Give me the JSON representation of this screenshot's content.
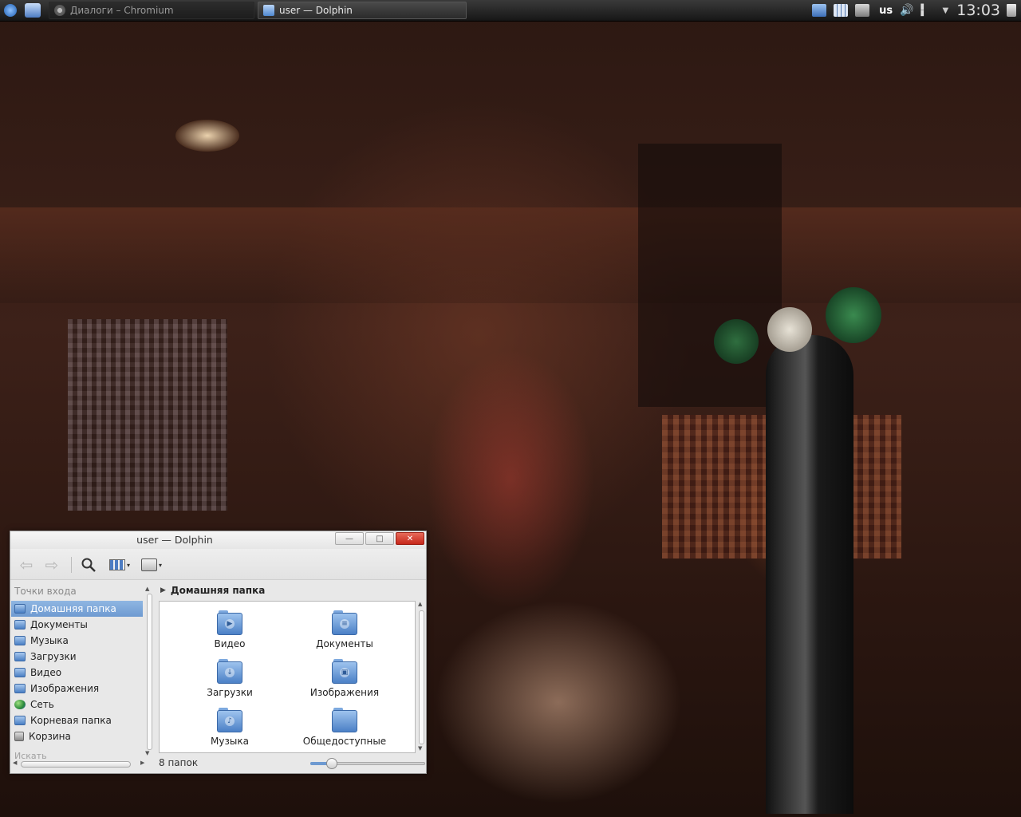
{
  "taskbar": {
    "tasks": [
      {
        "label": "Диалоги – Chromium",
        "icon": "chromium-icon",
        "active": false
      },
      {
        "label": "user — Dolphin",
        "icon": "folder-icon",
        "active": true
      }
    ],
    "tray": {
      "keyboard_layout": "us",
      "clock": "13:03",
      "icons": [
        "folder-icon",
        "grid-icon",
        "drive-icon",
        "volume-icon",
        "network-icon",
        "arrow-down-icon",
        "trash-icon"
      ]
    }
  },
  "window": {
    "title": "user — Dolphin",
    "controls": {
      "minimize": "—",
      "maximize": "□",
      "close": "✕"
    },
    "toolbar": {
      "back": "back-arrow-icon",
      "forward": "forward-arrow-icon",
      "search": "search-icon",
      "view_mode": "icons-view-icon",
      "preview": "camera-icon",
      "dropdown_glyph": "▾"
    },
    "sidebar": {
      "header": "Точки входа",
      "items": [
        {
          "label": "Домашняя папка",
          "icon": "home-folder-icon",
          "active": true
        },
        {
          "label": "Документы",
          "icon": "documents-folder-icon",
          "active": false
        },
        {
          "label": "Музыка",
          "icon": "music-folder-icon",
          "active": false
        },
        {
          "label": "Загрузки",
          "icon": "downloads-folder-icon",
          "active": false
        },
        {
          "label": "Видео",
          "icon": "video-folder-icon",
          "active": false
        },
        {
          "label": "Изображения",
          "icon": "pictures-folder-icon",
          "active": false
        },
        {
          "label": "Сеть",
          "icon": "network-globe-icon",
          "active": false
        },
        {
          "label": "Корневая папка",
          "icon": "root-folder-icon",
          "active": false
        },
        {
          "label": "Корзина",
          "icon": "trash-icon",
          "active": false
        }
      ],
      "search_header": "Искать"
    },
    "breadcrumb": {
      "arrow": "▶",
      "label": "Домашняя папка"
    },
    "files": [
      {
        "name": "Видео",
        "emblem": "▶"
      },
      {
        "name": "Документы",
        "emblem": "≡"
      },
      {
        "name": "Загрузки",
        "emblem": "↓"
      },
      {
        "name": "Изображения",
        "emblem": "▣"
      },
      {
        "name": "Музыка",
        "emblem": "♪"
      },
      {
        "name": "Общедоступные",
        "emblem": ""
      }
    ],
    "status": {
      "text": "8 папок",
      "zoom_level": 0.15
    }
  },
  "colors": {
    "accent": "#6e9ad1",
    "close_button": "#c6271a",
    "panel": "#161616"
  }
}
